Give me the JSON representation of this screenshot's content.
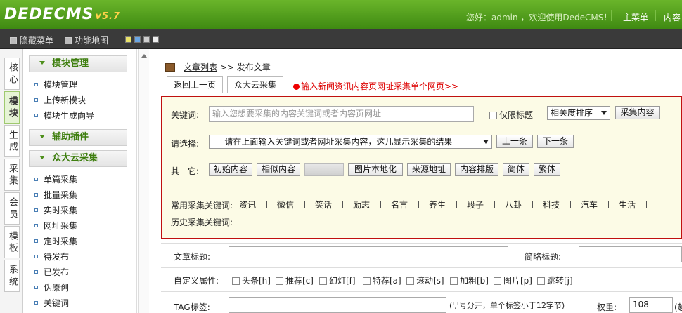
{
  "header": {
    "logo": "DEDECMS",
    "version": "v5.7",
    "welcome": "您好：admin ，欢迎使用DedeCMS！",
    "nav": [
      "主菜单",
      "内容"
    ]
  },
  "toolbar": {
    "hide_menu": "隐藏菜单",
    "site_map": "功能地图",
    "swatch_colors": [
      "#e9e36a",
      "#6aa6e3",
      "#cfcfcf",
      "#eeeeee"
    ]
  },
  "left_tabs": [
    "核心",
    "模块",
    "生成",
    "采集",
    "会员",
    "模板",
    "系统"
  ],
  "active_left_tab": "模块",
  "sidebar": {
    "sections": [
      {
        "title": "模块管理",
        "items": [
          "模块管理",
          "上传新模块",
          "模块生成向导"
        ]
      },
      {
        "title": "辅助插件",
        "items": []
      },
      {
        "title": "众大云采集",
        "items": [
          "单篇采集",
          "批量采集",
          "实时采集",
          "网址采集",
          "定时采集",
          "待发布",
          "已发布",
          "伪原创",
          "关键词"
        ]
      }
    ]
  },
  "breadcrumb": {
    "link": "文章列表",
    "separator": ">>",
    "current": "发布文章"
  },
  "tabs": {
    "back": "返回上一页",
    "collect": "众大云采集"
  },
  "hint": "输入新闻资讯内容页网址采集单个网页>>",
  "collect_panel": {
    "keyword_label": "关键词:",
    "keyword_placeholder": "输入您想要采集的内容关键词或者内容页网址",
    "title_only_label": "仅限标题",
    "sort_value": "相关度排序",
    "collect_button": "采集内容",
    "choose_label": "请选择:",
    "choose_value": "----请在上面输入关键词或者网址采集内容，这儿显示采集的结果----",
    "prev_button": "上一条",
    "next_button": "下一条",
    "other_label": "其　它:",
    "actions": [
      "初始内容",
      "相似内容",
      "图片本地化",
      "来源地址",
      "内容排版",
      "简体",
      "繁体"
    ],
    "common_keywords_label": "常用采集关键词:",
    "common_keywords": [
      "资讯",
      "微信",
      "笑话",
      "励志",
      "名言",
      "养生",
      "段子",
      "八卦",
      "科技",
      "汽车",
      "生活"
    ],
    "history_label": "历史采集关键词:"
  },
  "form": {
    "title_label": "文章标题:",
    "short_title_label": "简略标题:",
    "attr_label": "自定义属性:",
    "attrs": [
      "头条[h]",
      "推荐[c]",
      "幻灯[f]",
      "特荐[a]",
      "滚动[s]",
      "加粗[b]",
      "图片[p]",
      "跳转[j]"
    ],
    "tag_label": "TAG标签:",
    "tag_hint": "(','号分开，单个标签小于12字节)",
    "weight_label": "权重:",
    "weight_value": "108",
    "weight_suffix": "(越"
  }
}
